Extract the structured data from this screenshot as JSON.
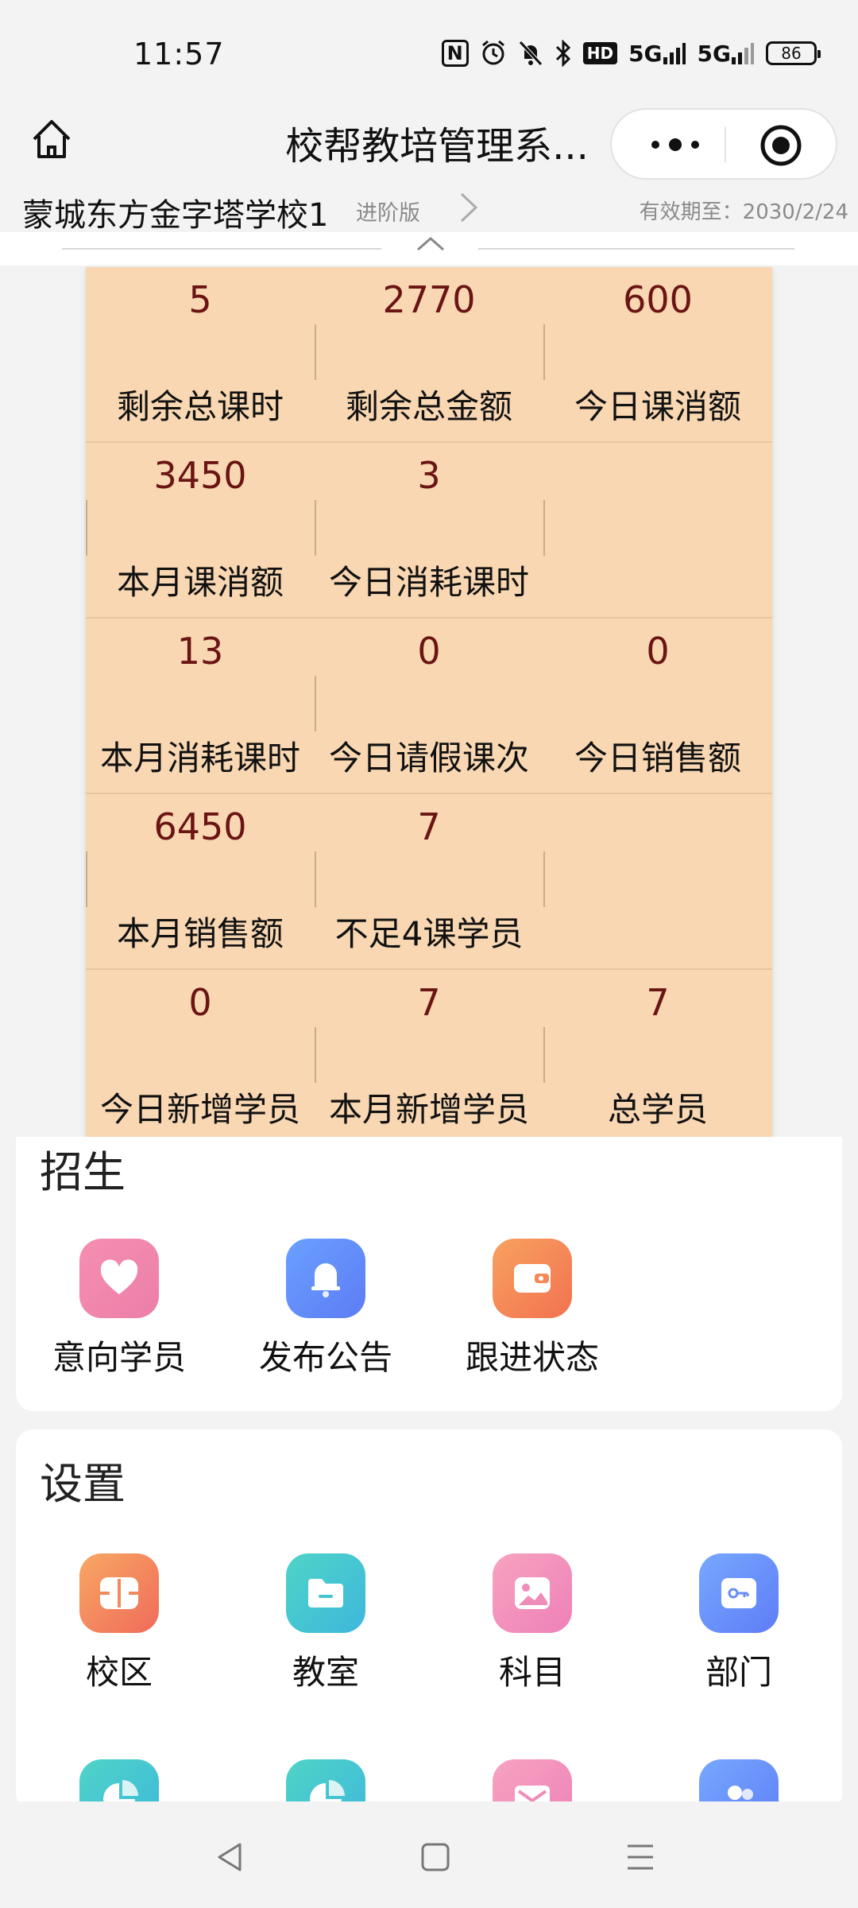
{
  "status_bar": {
    "time": "11:57",
    "icons": [
      "nfc-icon",
      "alarm-icon",
      "mute-icon",
      "bluetooth-icon",
      "hd-icon",
      "signal-5g-icon",
      "signal-5g-icon"
    ],
    "hd_label": "HD",
    "signal_label_1": "5G",
    "signal_label_2": "5G",
    "battery": "86"
  },
  "title_bar": {
    "title": "校帮教培管理系...",
    "home_icon": "home-icon",
    "more_icon": "more-dots-icon",
    "close_icon": "target-icon"
  },
  "school": {
    "name": "蒙城东方金字塔学校1",
    "tier": "进阶版",
    "expiry": "有效期至：2030/2/24"
  },
  "stats": {
    "rows": [
      [
        {
          "value": "5",
          "label": "剩余总课时"
        },
        {
          "value": "2770",
          "label": "剩余总金额"
        },
        {
          "value": "600",
          "label": "今日课消额"
        }
      ],
      [
        {
          "value": "3450",
          "label": "本月课消额"
        },
        {
          "value": "3",
          "label": "今日消耗课时"
        },
        {
          "value": "",
          "label": ""
        }
      ],
      [
        {
          "value": "13",
          "label": "本月消耗课时"
        },
        {
          "value": "0",
          "label": "今日请假课次"
        },
        {
          "value": "0",
          "label": "今日销售额"
        }
      ],
      [
        {
          "value": "6450",
          "label": "本月销售额"
        },
        {
          "value": "7",
          "label": "不足4课学员"
        },
        {
          "value": "",
          "label": ""
        }
      ],
      [
        {
          "value": "0",
          "label": "今日新增学员"
        },
        {
          "value": "7",
          "label": "本月新增学员"
        },
        {
          "value": "7",
          "label": "总学员"
        }
      ]
    ]
  },
  "recruit": {
    "title": "招生",
    "items": [
      {
        "label": "意向学员",
        "icon": "heart-icon"
      },
      {
        "label": "发布公告",
        "icon": "bell-icon"
      },
      {
        "label": "跟进状态",
        "icon": "wallet-icon"
      }
    ]
  },
  "settings": {
    "title": "设置",
    "items": [
      {
        "label": "校区",
        "icon": "campus-icon"
      },
      {
        "label": "教室",
        "icon": "folder-icon"
      },
      {
        "label": "科目",
        "icon": "image-icon"
      },
      {
        "label": "部门",
        "icon": "key-icon"
      }
    ],
    "partial_row_icons": [
      "pie-chart-icon",
      "pie-chart-icon",
      "mail-icon",
      "users-icon"
    ]
  },
  "nav": {
    "back_icon": "back-triangle-icon",
    "home_icon": "square-home-icon",
    "menu_icon": "menu-lines-icon"
  },
  "colors": {
    "stats_bg": "#f8d7b2",
    "value_color": "#6a1414"
  }
}
